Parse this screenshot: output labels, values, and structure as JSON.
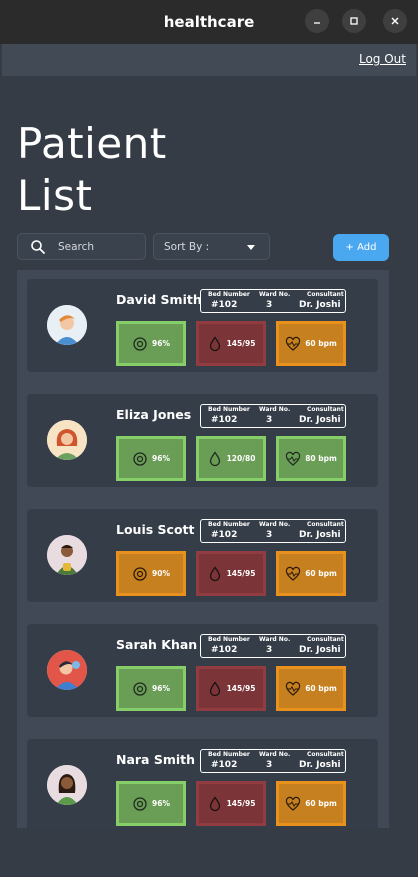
{
  "window": {
    "title": "healthcare"
  },
  "topbar": {
    "logout_label": "Log Out"
  },
  "page": {
    "title_line1": "Patient",
    "title_line2": "List"
  },
  "toolbar": {
    "search_label": "Search",
    "sort_label": "Sort By :",
    "add_label": "+ Add"
  },
  "table_headers": {
    "bed": "Bed Number",
    "ward": "Ward No.",
    "consultant": "Consultant"
  },
  "patients": [
    {
      "name": "David Smith",
      "bed": "#102",
      "ward": "3",
      "consultant": "Dr. Joshi",
      "oxygen": "96%",
      "oxygen_status": "green",
      "bp": "145/95",
      "bp_status": "red",
      "hr": "60 bpm",
      "hr_status": "orange"
    },
    {
      "name": "Eliza Jones",
      "bed": "#102",
      "ward": "3",
      "consultant": "Dr. Joshi",
      "oxygen": "96%",
      "oxygen_status": "green",
      "bp": "120/80",
      "bp_status": "green",
      "hr": "80 bpm",
      "hr_status": "green"
    },
    {
      "name": "Louis Scott",
      "bed": "#102",
      "ward": "3",
      "consultant": "Dr. Joshi",
      "oxygen": "90%",
      "oxygen_status": "orange",
      "bp": "145/95",
      "bp_status": "red",
      "hr": "60 bpm",
      "hr_status": "orange"
    },
    {
      "name": "Sarah Khan",
      "bed": "#102",
      "ward": "3",
      "consultant": "Dr. Joshi",
      "oxygen": "96%",
      "oxygen_status": "green",
      "bp": "145/95",
      "bp_status": "red",
      "hr": "60 bpm",
      "hr_status": "orange"
    },
    {
      "name": "Nara Smith",
      "bed": "#102",
      "ward": "3",
      "consultant": "Dr. Joshi",
      "oxygen": "96%",
      "oxygen_status": "green",
      "bp": "145/95",
      "bp_status": "red",
      "hr": "60 bpm",
      "hr_status": "orange"
    }
  ],
  "colors": {
    "accent": "#4aa8f0",
    "green": "#6a9d56",
    "red": "#7b3538",
    "orange": "#c7801f"
  }
}
